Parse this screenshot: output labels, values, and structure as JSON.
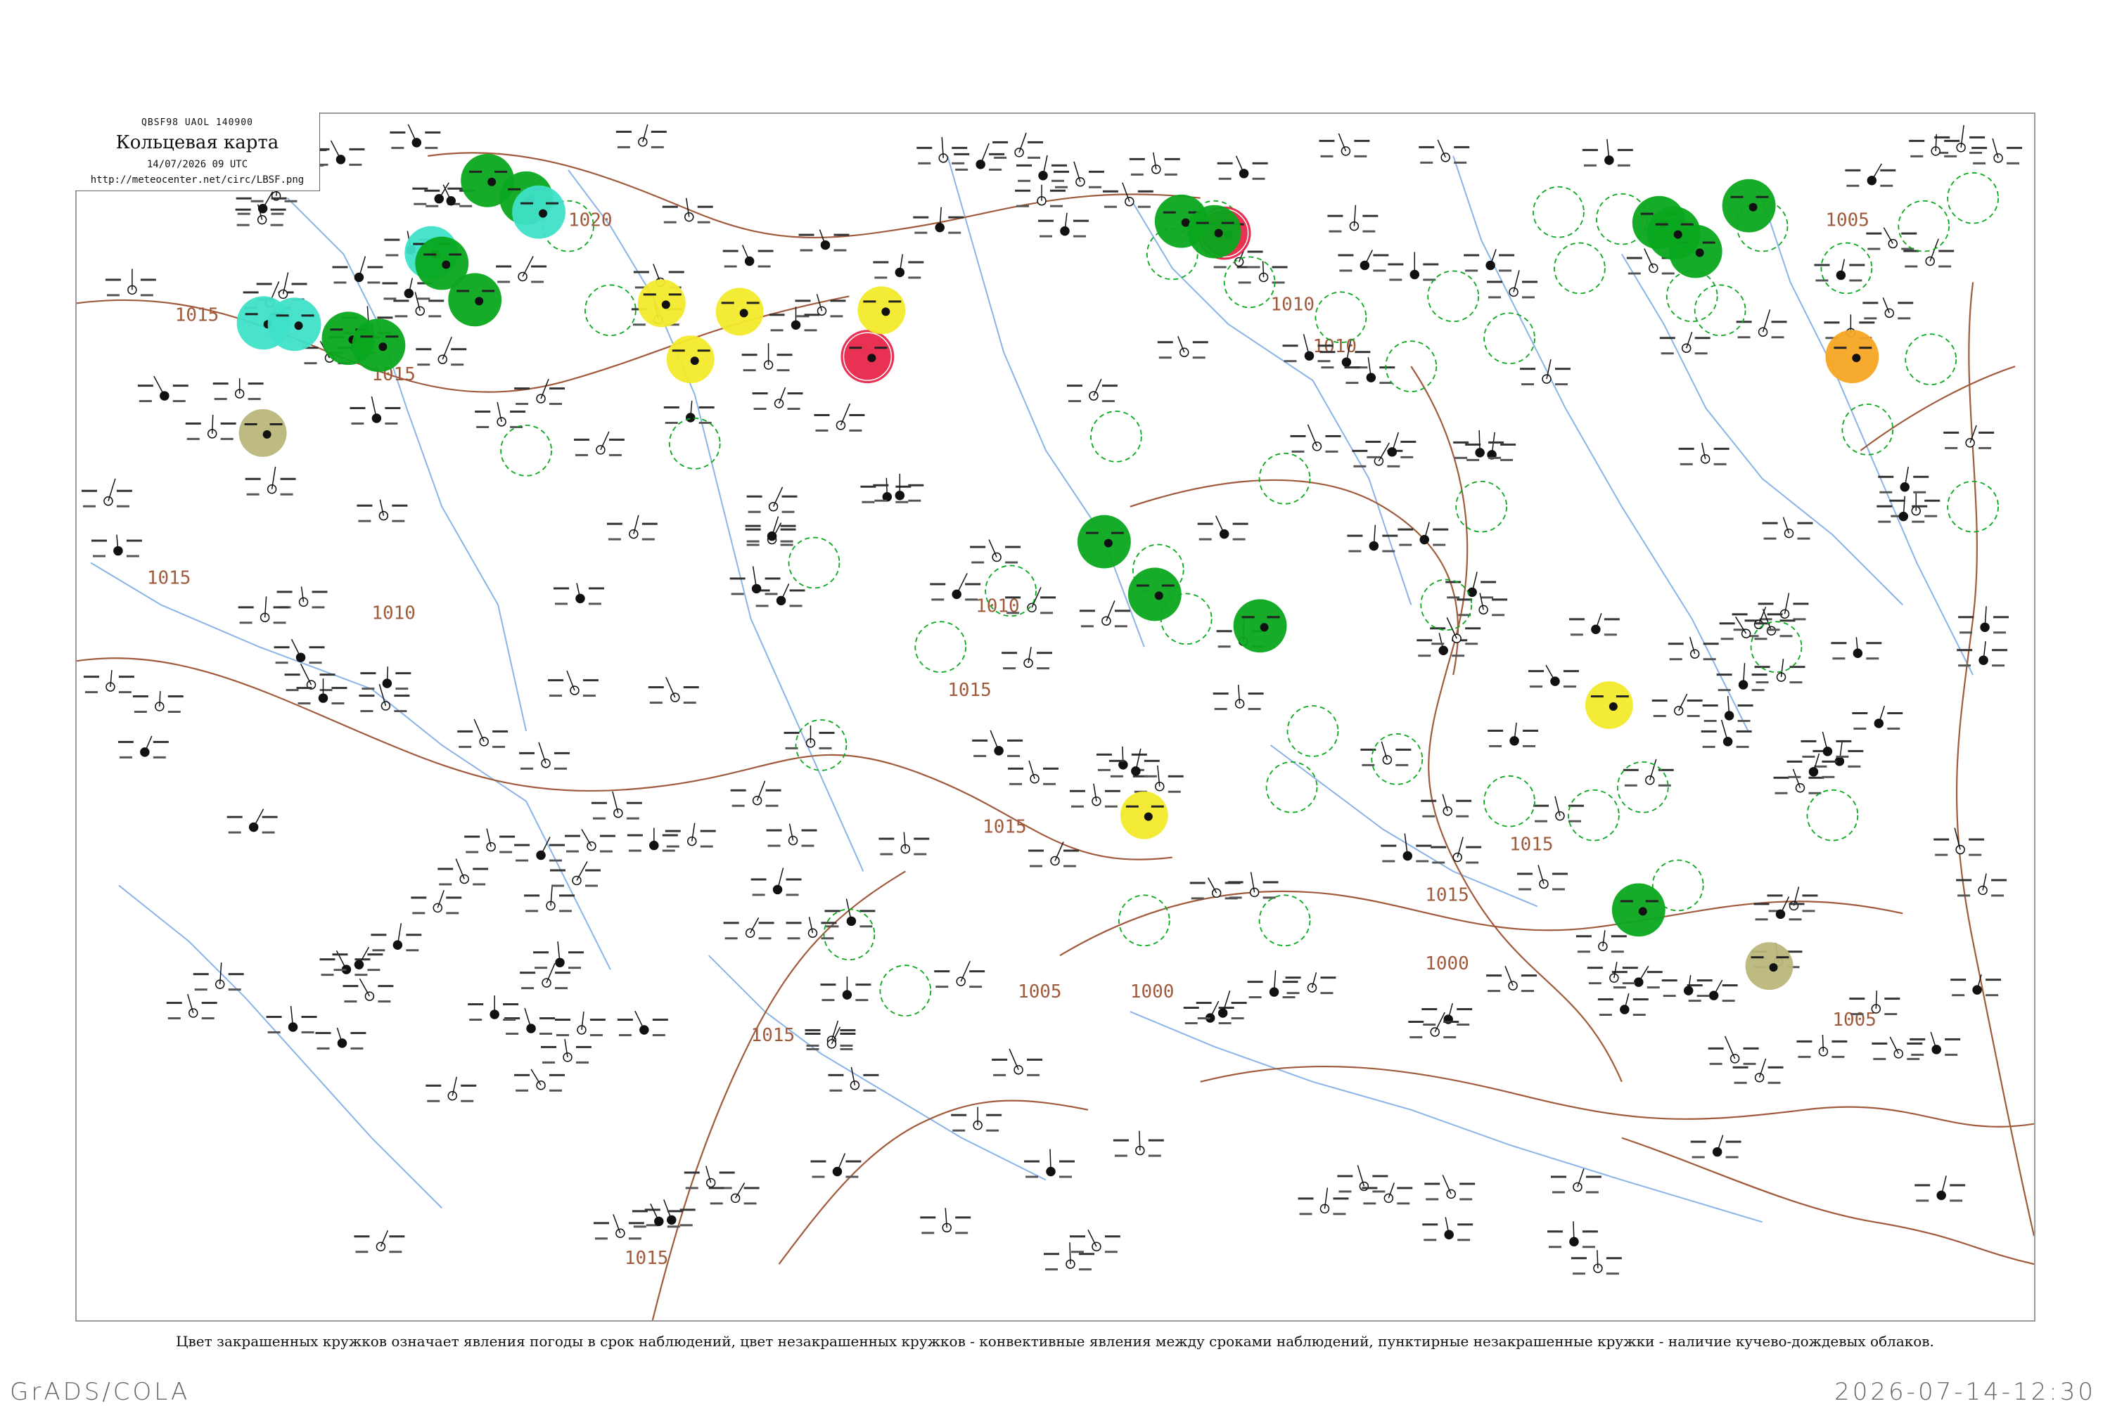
{
  "header": {
    "code_line": "QBSF98  UAOL  140900",
    "title": "Кольцевая карта",
    "datetime": "14/07/2026 09 UTC",
    "url": "http://meteocenter.net/circ/LBSF.png"
  },
  "caption": "Цвет закрашенных кружков означает явления погоды в срок наблюдений, цвет незакрашенных кружков - конвективные явления между сроками наблюдений, пунктирные незакрашенные кружки - наличие кучево-дождевых облаков.",
  "footer": {
    "brand": "GrADS/COLA",
    "timestamp": "2026-07-14-12:30"
  },
  "isobar_labels": [
    "1015",
    "1020",
    "1015",
    "1010",
    "1005",
    "1010",
    "1015",
    "1015",
    "1015",
    "1010",
    "1005",
    "1000",
    "1005",
    "1015",
    "1015",
    "1010",
    "1000",
    "1015",
    "1015"
  ],
  "colors": {
    "isobar": "#a05a3c",
    "water": "#8ab4e8",
    "rain": "#0aa81e",
    "thunderstorm": "#e8264a",
    "fog_mist": "#f2ea2a",
    "shower": "#f5a623",
    "haze": "#b9b77a",
    "snow_drizzle": "#3fe0c8",
    "cb_dashed": "#0aa81e"
  },
  "filled_stations": [
    {
      "kind": "rain"
    },
    {
      "kind": "rain"
    },
    {
      "kind": "snow_drizzle"
    },
    {
      "kind": "snow_drizzle"
    },
    {
      "kind": "rain"
    },
    {
      "kind": "snow_drizzle"
    },
    {
      "kind": "snow_drizzle"
    },
    {
      "kind": "rain"
    },
    {
      "kind": "rain"
    },
    {
      "kind": "rain"
    },
    {
      "kind": "haze"
    },
    {
      "kind": "fog_mist"
    },
    {
      "kind": "fog_mist"
    },
    {
      "kind": "fog_mist"
    },
    {
      "kind": "thunderstorm"
    },
    {
      "kind": "fog_mist"
    },
    {
      "kind": "fog_mist"
    },
    {
      "kind": "rain"
    },
    {
      "kind": "rain"
    },
    {
      "kind": "rain"
    },
    {
      "kind": "thunderstorm"
    },
    {
      "kind": "rain"
    },
    {
      "kind": "rain"
    },
    {
      "kind": "fog_mist"
    },
    {
      "kind": "rain"
    },
    {
      "kind": "rain"
    },
    {
      "kind": "shower"
    },
    {
      "kind": "rain"
    },
    {
      "kind": "rain"
    },
    {
      "kind": "haze"
    },
    {
      "kind": "rain"
    }
  ],
  "dashed_circle_count": 46,
  "station_plot_count": 260
}
